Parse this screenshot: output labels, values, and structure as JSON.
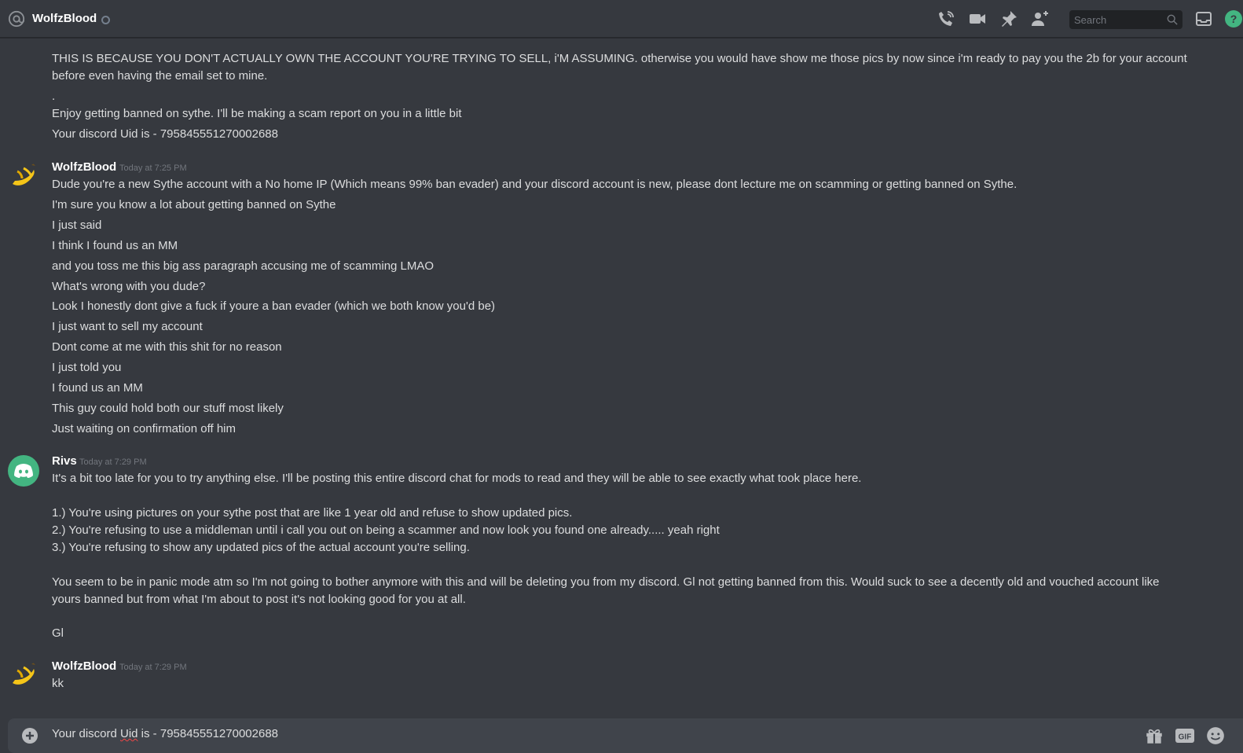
{
  "header": {
    "title": "WolfzBlood",
    "search_placeholder": "Search",
    "icons": [
      "at-icon",
      "status-dot",
      "call-icon",
      "video-icon",
      "pin-icon",
      "add-member-icon",
      "search-icon",
      "inbox-icon",
      "help-icon"
    ]
  },
  "messages": {
    "m0": {
      "lines": [
        "THIS IS BECAUSE YOU DON'T ACTUALLY OWN THE ACCOUNT YOU'RE TRYING TO SELL, i'M ASSUMING. otherwise you would have show me those pics by now since i'm ready to pay you the 2b for your account before even having the email set to mine.",
        ".",
        "Enjoy getting banned on sythe. I'll be making a scam report on you in a little bit",
        "Your discord Uid is - 795845551270002688"
      ]
    },
    "m1": {
      "author": "WolfzBlood",
      "timestamp": "Today at 7:25 PM",
      "lines": [
        "Dude you're a new Sythe account with a No home IP (Which means 99% ban evader) and your discord account is new, please dont lecture me on scamming or getting banned on Sythe.",
        "I'm sure you know a lot about getting banned on Sythe",
        "I just said",
        "I think I found us an MM",
        "and you toss me this big ass paragraph accusing me of scamming LMAO",
        "What's wrong with you dude?",
        "Look I honestly dont give a fuck if youre a ban evader (which we both know you'd be)",
        "I just want to sell my account",
        "Dont come at me with this shit for no reason",
        "I just told you",
        "I found us an MM",
        "This guy could hold both our stuff most likely",
        "Just waiting on confirmation off him"
      ]
    },
    "m2": {
      "author": "Rivs",
      "timestamp": "Today at 7:29 PM",
      "lines": [
        "It's a bit too late for you to try anything else. I'll be posting this entire discord chat for mods to read and they will be able to see exactly what took place here.",
        "1.) You're using pictures on your sythe post that are like 1 year old and refuse to show updated pics.",
        "2.) You're refusing to use a middleman until i call you out on being a scammer and now look you found one already..... yeah right",
        "3.) You're refusing to show any updated pics of the actual account you're selling.",
        "You seem to be in panic mode atm so I'm not going to bother anymore with this and will be deleting you from my discord. Gl not getting banned from this. Would suck to see a decently old and vouched account like yours banned but from what I'm about to post it's not looking good for you at all.",
        "Gl"
      ]
    },
    "m3": {
      "author": "WolfzBlood",
      "timestamp": "Today at 7:29 PM",
      "lines": [
        "kk"
      ]
    }
  },
  "composer": {
    "prefix": "Your discord ",
    "misspelled": "Uid",
    "suffix": " is - 795845551270002688",
    "gif_label": "GIF"
  },
  "colors": {
    "background": "#36393f",
    "composer": "#40444b",
    "discord_blurple_green": "#43b581",
    "text": "#dcddde",
    "muted": "#72767d"
  }
}
